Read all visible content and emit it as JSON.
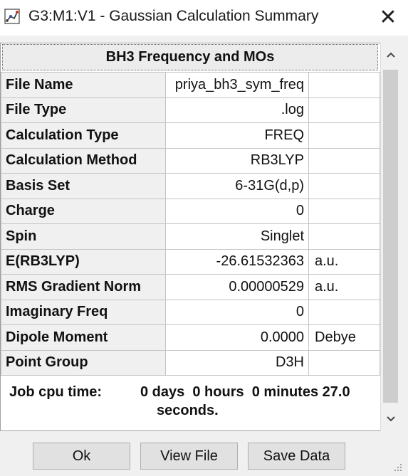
{
  "window": {
    "title": "G3:M1:V1 - Gaussian Calculation Summary",
    "close_glyph": "✕",
    "app_icon": "gaussview-molecule-icon"
  },
  "summary": {
    "header": "BH3 Frequency and MOs",
    "rows": [
      {
        "label": "File Name",
        "value": "priya_bh3_sym_freq",
        "unit": ""
      },
      {
        "label": "File Type",
        "value": ".log",
        "unit": ""
      },
      {
        "label": "Calculation Type",
        "value": "FREQ",
        "unit": ""
      },
      {
        "label": "Calculation Method",
        "value": "RB3LYP",
        "unit": ""
      },
      {
        "label": "Basis Set",
        "value": "6-31G(d,p)",
        "unit": ""
      },
      {
        "label": "Charge",
        "value": "0",
        "unit": ""
      },
      {
        "label": "Spin",
        "value": "Singlet",
        "unit": ""
      },
      {
        "label": "E(RB3LYP)",
        "value": "-26.61532363",
        "unit": "a.u."
      },
      {
        "label": "RMS Gradient Norm",
        "value": "0.00000529",
        "unit": "a.u."
      },
      {
        "label": "Imaginary Freq",
        "value": "0",
        "unit": ""
      },
      {
        "label": "Dipole Moment",
        "value": "0.0000",
        "unit": "Debye"
      },
      {
        "label": "Point Group",
        "value": "D3H",
        "unit": ""
      }
    ],
    "job_cpu_label": "Job cpu time:",
    "job_cpu_line1": "0 days  0 hours  0 minutes 27.0",
    "job_cpu_line2": "seconds."
  },
  "buttons": {
    "ok": "Ok",
    "view_file": "View File",
    "save_data": "Save Data"
  },
  "colors": {
    "label_cell_bg": "#f0f0f0",
    "header_bg": "#ececec",
    "button_bg": "#e1e1e1",
    "scroll_thumb": "#cdcdcd"
  }
}
